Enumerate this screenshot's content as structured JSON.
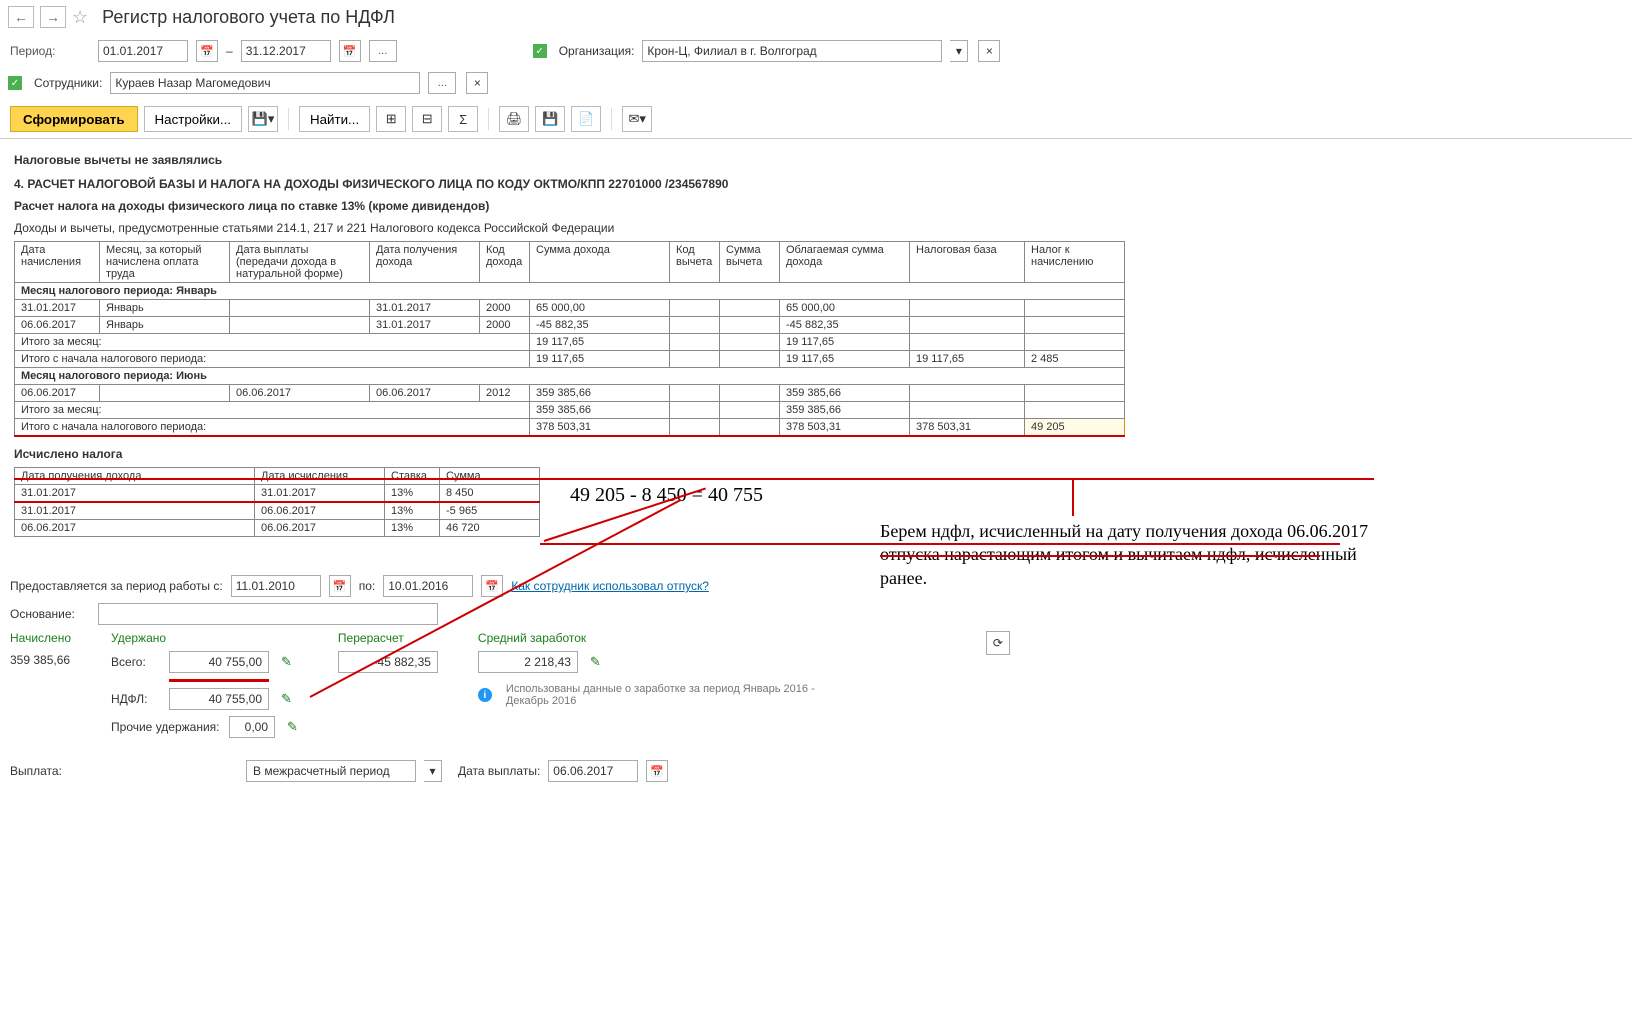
{
  "page": {
    "title": "Регистр налогового учета по НДФЛ"
  },
  "filters": {
    "period_label": "Период:",
    "date_from": "01.01.2017",
    "date_to": "31.12.2017",
    "dash": "–",
    "org_label": "Организация:",
    "org_value": "Крон-Ц, Филиал в г. Волгоград",
    "emp_label": "Сотрудники:",
    "emp_value": "Кураев Назар Магомедович",
    "dots": "..."
  },
  "toolbar": {
    "form": "Сформировать",
    "settings": "Настройки...",
    "find": "Найти..."
  },
  "report": {
    "line1": "Налоговые вычеты не заявлялись",
    "line2": "4. РАСЧЕТ НАЛОГОВОЙ БАЗЫ И НАЛОГА НА ДОХОДЫ ФИЗИЧЕСКОГО ЛИЦА ПО КОДУ ОКТМО/КПП 22701000   /234567890",
    "line3": "Расчет налога на доходы физического лица по ставке 13% (кроме дивидендов)",
    "line4": "Доходы и вычеты, предусмотренные статьями 214.1, 217 и 221 Налогового кодекса Российской Федерации",
    "headers": {
      "h1": "Дата начисления",
      "h2": "Месяц, за который начислена оплата труда",
      "h3": "Дата выплаты (передачи дохода в натуральной форме)",
      "h4": "Дата получения дохода",
      "h5": "Код дохода",
      "h6": "Сумма дохода",
      "h7": "Код вычета",
      "h8": "Сумма вычета",
      "h9": "Облагаемая сумма дохода",
      "h10": "Налоговая база",
      "h11": "Налог к начислению"
    },
    "group_jan": "Месяц налогового периода: Январь",
    "row1": {
      "c1": "31.01.2017",
      "c2": "Январь",
      "c4": "31.01.2017",
      "c5": "2000",
      "c6": "65 000,00",
      "c9": "65 000,00"
    },
    "row2": {
      "c1": "06.06.2017",
      "c2": "Январь",
      "c4": "31.01.2017",
      "c5": "2000",
      "c6": "-45 882,35",
      "c9": "-45 882,35"
    },
    "sub_month": "Итого за месяц:",
    "sub_period": "Итого с начала налогового периода:",
    "jan_month": {
      "c6": "19 117,65",
      "c9": "19 117,65"
    },
    "jan_period": {
      "c6": "19 117,65",
      "c9": "19 117,65",
      "c10": "19 117,65",
      "c11": "2 485"
    },
    "group_jun": "Месяц налогового периода: Июнь",
    "row3": {
      "c1": "06.06.2017",
      "c3": "06.06.2017",
      "c4": "06.06.2017",
      "c5": "2012",
      "c6": "359 385,66",
      "c9": "359 385,66"
    },
    "jun_month": {
      "c6": "359 385,66",
      "c9": "359 385,66"
    },
    "jun_period": {
      "c6": "378 503,31",
      "c9": "378 503,31",
      "c10": "378 503,31",
      "c11": "49 205"
    },
    "tax_title": "Исчислено налога",
    "tax_headers": {
      "h1": "Дата получения дохода",
      "h2": "Дата исчисления",
      "h3": "Ставка",
      "h4": "Сумма"
    },
    "tax_rows": [
      {
        "c1": "31.01.2017",
        "c2": "31.01.2017",
        "c3": "13%",
        "c4": "8 450"
      },
      {
        "c1": "31.01.2017",
        "c2": "06.06.2017",
        "c3": "13%",
        "c4": "-5 965"
      },
      {
        "c1": "06.06.2017",
        "c2": "06.06.2017",
        "c3": "13%",
        "c4": "46 720"
      }
    ]
  },
  "bottom": {
    "period_label": "Предоставляется за период работы с:",
    "from": "11.01.2010",
    "to_label": "по:",
    "to": "10.01.2016",
    "link": "Как сотрудник использовал отпуск?",
    "basis_label": "Основание:",
    "accrued_label": "Начислено",
    "accrued_value": "359 385,66",
    "withheld_label": "Удержано",
    "recalc_label": "Перерасчет",
    "recalc_value": "-45 882,35",
    "avg_label": "Средний заработок",
    "avg_value": "2 218,43",
    "total_label": "Всего:",
    "total_value": "40 755,00",
    "ndfl_label": "НДФЛ:",
    "ndfl_value": "40 755,00",
    "other_label": "Прочие удержания:",
    "other_value": "0,00",
    "info": "Использованы данные о заработке за период Январь 2016 - Декабрь 2016",
    "payment_label": "Выплата:",
    "payment_value": "В межрасчетный период",
    "paydate_label": "Дата выплаты:",
    "paydate_value": "06.06.2017"
  },
  "annotations": {
    "formula": "49 205 - 8 450 =   40 755",
    "note": "Берем ндфл, исчисленный на дату получения дохода 06.06.2017 отпуска нарастающим итогом и вычитаем ндфл, исчисленный ранее."
  }
}
